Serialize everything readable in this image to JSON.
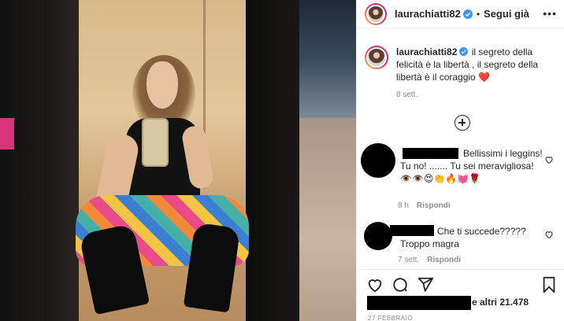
{
  "post": {
    "image_alt": "",
    "colors": {
      "verified": "#3897f0",
      "heart": "#e0245e",
      "muted": "#8e8e8e",
      "text": "#262626"
    }
  },
  "header": {
    "username": "laurachiatti82",
    "separator": "•",
    "follow_label": "Segui già",
    "more_icon": "more-icon"
  },
  "caption": {
    "username": "laurachiatti82",
    "text": " il segreto della felicità è la libertà , il segreto della libertà è il coraggio",
    "emoji": "❤️",
    "time": "8 sett."
  },
  "load_more_icon": "plus-circle-icon",
  "comments": [
    {
      "text": "Bellissimi i leggins! Tu no! ....... Tu sei meravigliosa! 👁️👁️😍👏🔥💓🌹",
      "time": "8 h",
      "reply_label": "Rispondi"
    },
    {
      "text": "Che ti succede????? Troppo magra",
      "time": "7 sett.",
      "reply_label": "Rispondi"
    }
  ],
  "actions": {
    "like_icon": "heart-icon",
    "comment_icon": "comment-icon",
    "share_icon": "share-icon",
    "save_icon": "bookmark-icon"
  },
  "likes": {
    "text": "e altri 21.478"
  },
  "date": "27 FEBBRAIO"
}
